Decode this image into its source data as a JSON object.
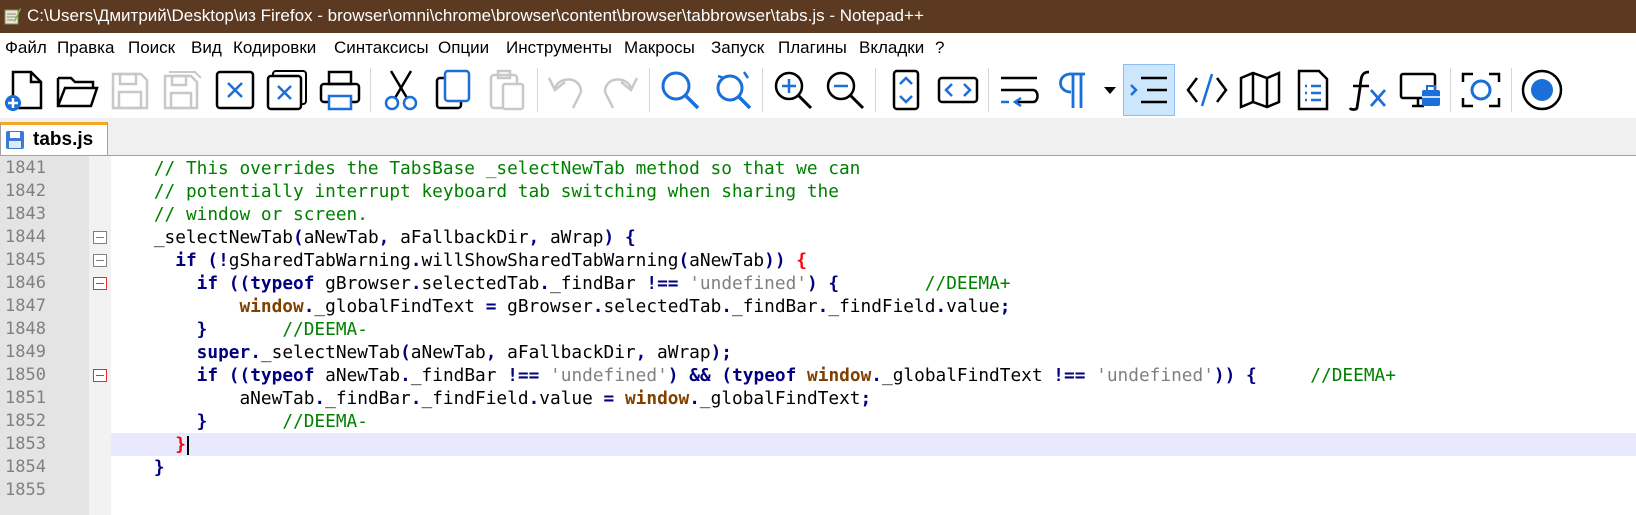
{
  "window": {
    "title": "C:\\Users\\Дмитрий\\Desktop\\из Firefox - browser\\omni\\chrome\\browser\\content\\browser\\tabbrowser\\tabs.js - Notepad++"
  },
  "menu": {
    "file": "Файл",
    "edit": "Правка",
    "search": "Поиск",
    "view": "Вид",
    "encoding": "Кодировки",
    "language": "Синтаксисы",
    "settings": "Опции",
    "tools": "Инструменты",
    "macro": "Макросы",
    "run": "Запуск",
    "plugins": "Плагины",
    "window": "Вкладки",
    "help": "?"
  },
  "toolbar": {
    "icons": [
      "new-file-icon",
      "open-file-icon",
      "save-icon",
      "save-all-icon",
      "close-icon",
      "close-all-icon",
      "print-icon",
      "cut-icon",
      "copy-icon",
      "paste-icon",
      "undo-icon",
      "redo-icon",
      "find-icon",
      "replace-icon",
      "zoom-in-icon",
      "zoom-out-icon",
      "sync-scroll-icon",
      "wrap-icon",
      "word-wrap-icon",
      "show-symbols-icon",
      "indent-guide-icon",
      "xml-tags-icon",
      "document-map-icon",
      "document-list-icon",
      "function-list-icon",
      "folder-workspace-icon",
      "monitoring-icon",
      "record-macro-icon"
    ],
    "active": "indent-guide-icon"
  },
  "tabs": [
    {
      "label": "tabs.js"
    }
  ],
  "editor": {
    "lines": [
      {
        "num": "1841",
        "text": "    // This overrides the TabsBase _selectNewTab method so that we can"
      },
      {
        "num": "1842",
        "text": "    // potentially interrupt keyboard tab switching when sharing the"
      },
      {
        "num": "1843",
        "text": "    // window or screen."
      },
      {
        "num": "1844",
        "text": "    _selectNewTab(aNewTab, aFallbackDir, aWrap) {"
      },
      {
        "num": "1845",
        "text": "      if (!gSharedTabWarning.willShowSharedTabWarning(aNewTab)) {"
      },
      {
        "num": "1846",
        "text": "        if ((typeof gBrowser.selectedTab._findBar !== 'undefined') {        //DEEMA+"
      },
      {
        "num": "1847",
        "text": "            window._globalFindText = gBrowser.selectedTab._findBar._findField.value;"
      },
      {
        "num": "1848",
        "text": "        }       //DEEMA-"
      },
      {
        "num": "1849",
        "text": "        super._selectNewTab(aNewTab, aFallbackDir, aWrap);"
      },
      {
        "num": "1850",
        "text": "        if ((typeof aNewTab._findBar !== 'undefined') && (typeof window._globalFindText !== 'undefined')) {     //DEEMA+"
      },
      {
        "num": "1851",
        "text": "            aNewTab._findBar._findField.value = window._globalFindText;"
      },
      {
        "num": "1852",
        "text": "        }       //DEEMA-"
      },
      {
        "num": "1853",
        "text": "      }"
      },
      {
        "num": "1854",
        "text": "    }"
      },
      {
        "num": "1855",
        "text": ""
      }
    ],
    "current_line": "1853",
    "colors": {
      "comment": "#008000",
      "keyword": "#000080",
      "string": "#808080",
      "instance": "#804000",
      "brace_match": "#ff0000",
      "current_line_bg": "#e8e8ff",
      "title_bar": "#5c3a21"
    }
  }
}
